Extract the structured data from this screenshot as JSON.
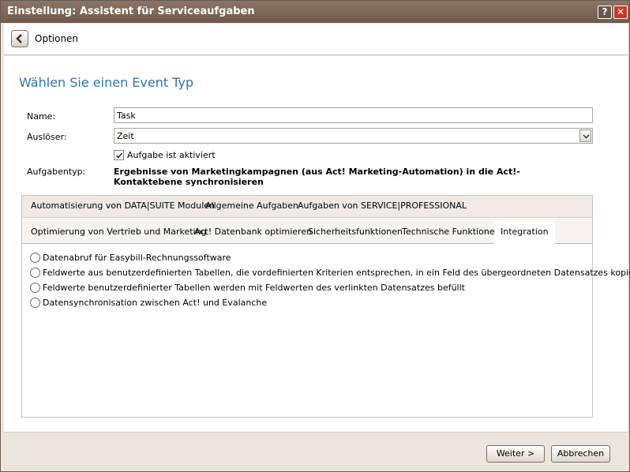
{
  "window": {
    "title": "Einstellung: Assistent für Serviceaufgaben",
    "help_label": "?",
    "close_label": "✕"
  },
  "nav": {
    "back_label": "Optionen"
  },
  "main": {
    "heading": "Wählen Sie einen Event Typ",
    "name_label": "Name:",
    "name_value": "Task",
    "trigger_label": "Auslöser:",
    "trigger_value": "Zeit",
    "checkbox_label": "Aufgabe ist aktiviert",
    "checkbox_checked": true,
    "task_type_label": "Aufgabentyp:",
    "task_type_value": "Ergebnisse von Marketingkampagnen (aus Act! Marketing-Automation) in die Act!-Kontaktebene synchronisieren"
  },
  "tabs": {
    "row1": [
      "Automatisierung von DATA|SUITE Modulen",
      "Allgemeine Aufgaben",
      "Aufgaben von SERVICE|PROFESSIONAL"
    ],
    "row2": [
      "Optimierung von Vertrieb und Marketing",
      "Act! Datenbank optimieren",
      "Sicherheitsfunktionen",
      "Technische Funktionen",
      "Integration"
    ],
    "active": "Integration"
  },
  "options": [
    "Datenabruf für Easybill-Rechnungssoftware",
    "Feldwerte aus benutzerdefinierten Tabellen, die vordefinierten Kriterien entsprechen, in ein Feld des übergeordneten Datensatzes kopieren",
    "Feldwerte benutzerdefinierter Tabellen werden mit Feldwerten des verlinkten Datensatzes befüllt",
    "Datensynchronisation zwischen Act! und Evalanche"
  ],
  "footer": {
    "next_label": "Weiter >",
    "cancel_label": "Abbrechen"
  }
}
